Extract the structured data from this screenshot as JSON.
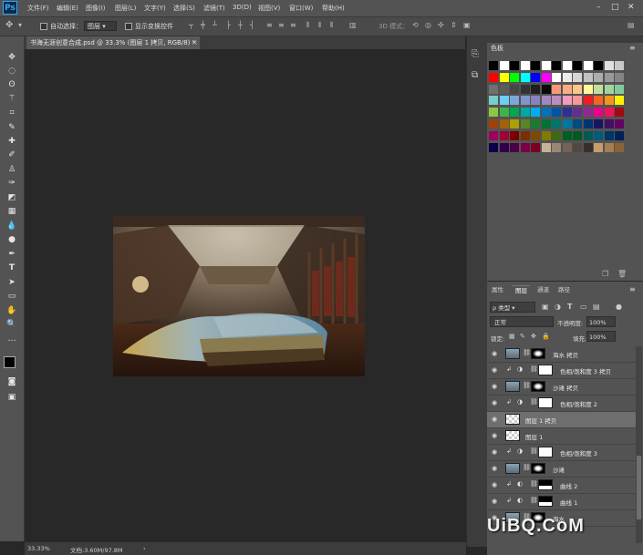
{
  "app": {
    "logo": "Ps"
  },
  "menu": [
    "文件(F)",
    "编辑(E)",
    "图像(I)",
    "图层(L)",
    "文字(Y)",
    "选择(S)",
    "滤镜(T)",
    "3D(D)",
    "视图(V)",
    "窗口(W)",
    "帮助(H)"
  ],
  "window_controls": {
    "minimize": "–",
    "maximize": "□",
    "close": "✕"
  },
  "options": {
    "auto_select_label": "自动选择：",
    "auto_select_value": "图层",
    "transform_controls_label": "显示变换控件",
    "mode_3d_label": "3D 模式："
  },
  "document": {
    "tab_title": "书海无涯创意合成.psd @ 33.3% (图层 1 拷贝, RGB/8) *",
    "tab_close": "×"
  },
  "status": {
    "zoom": "33.33%",
    "doc_size": "文档:3.60M/97.8M"
  },
  "swatches_panel": {
    "title": "色板"
  },
  "layers_panel": {
    "tabs": [
      "属性",
      "图层",
      "通道",
      "路径"
    ],
    "filter_label": "ρ 类型",
    "blend_mode": "正常",
    "opacity_label": "不透明度:",
    "opacity_value": "100%",
    "lock_label": "锁定:",
    "fill_label": "填充:",
    "fill_value": "100%",
    "layers": [
      {
        "name": "海水 拷贝",
        "type": "photo-mask"
      },
      {
        "name": "色相/饱和度 3 拷贝",
        "type": "adjust"
      },
      {
        "name": "沙滩 拷贝",
        "type": "photo-mask"
      },
      {
        "name": "色相/饱和度 2",
        "type": "adjust"
      },
      {
        "name": "图层 1 拷贝",
        "type": "transparent",
        "selected": true
      },
      {
        "name": "图层 1",
        "type": "transparent"
      },
      {
        "name": "色相/饱和度 3",
        "type": "adjust"
      },
      {
        "name": "沙滩",
        "type": "photo-mask"
      },
      {
        "name": "曲线 2",
        "type": "curve"
      },
      {
        "name": "曲线 1",
        "type": "curve"
      },
      {
        "name": "海水",
        "type": "photo-mask"
      }
    ]
  },
  "watermark": "UiBQ.CoM",
  "colors": {
    "accent": "#31a8ff",
    "panel": "#535353",
    "canvas": "#282828"
  }
}
